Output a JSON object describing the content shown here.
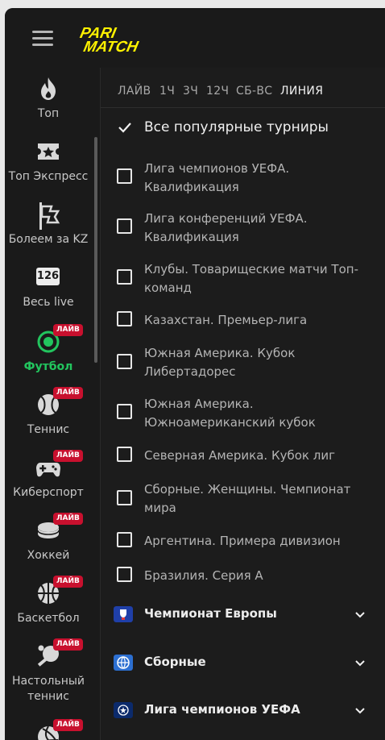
{
  "brand": {
    "logo_line1": "PARI",
    "logo_line2": "MATCH",
    "accent": "#fff200"
  },
  "sidebar": {
    "items": [
      {
        "label": "Топ",
        "icon": "flame-icon"
      },
      {
        "label": "Топ Экспресс",
        "icon": "ticket-star-icon"
      },
      {
        "label": "Болеем за KZ",
        "icon": "flag-icon"
      },
      {
        "label": "Весь live",
        "icon": "live-count-icon",
        "count": "126"
      },
      {
        "label": "Футбол",
        "icon": "football-icon",
        "badge": "ЛАЙВ",
        "active": true
      },
      {
        "label": "Теннис",
        "icon": "tennis-ball-icon",
        "badge": "ЛАЙВ"
      },
      {
        "label": "Киберспорт",
        "icon": "gamepad-icon",
        "badge": "ЛАЙВ"
      },
      {
        "label": "Хоккей",
        "icon": "hockey-puck-icon",
        "badge": "ЛАЙВ"
      },
      {
        "label": "Баскетбол",
        "icon": "basketball-icon",
        "badge": "ЛАЙВ"
      },
      {
        "label": "Настольный теннис",
        "icon": "table-tennis-icon",
        "badge": "ЛАЙВ"
      },
      {
        "label": "",
        "icon": "volleyball-icon",
        "badge": "ЛАЙВ"
      }
    ]
  },
  "tabs": [
    {
      "label": "ЛАЙВ"
    },
    {
      "label": "1Ч"
    },
    {
      "label": "3Ч"
    },
    {
      "label": "12Ч"
    },
    {
      "label": "СБ-ВС"
    },
    {
      "label": "ЛИНИЯ",
      "active": true
    }
  ],
  "all_popular": {
    "label": "Все популярные турниры",
    "checked": true
  },
  "tournaments": [
    {
      "label": "Лига чемпионов УЕФА. Квалификация",
      "checked": false
    },
    {
      "label": "Лига конференций УЕФА. Квалификация",
      "checked": false
    },
    {
      "label": "Клубы. Товарищеские матчи Топ-команд",
      "checked": false
    },
    {
      "label": "Казахстан. Премьер-лига",
      "checked": false
    },
    {
      "label": "Южная Америка. Кубок Либертадорес",
      "checked": false
    },
    {
      "label": "Южная Америка. Южноамериканский кубок",
      "checked": false
    },
    {
      "label": "Северная Америка. Кубок лиг",
      "checked": false
    },
    {
      "label": "Сборные. Женщины. Чемпионат мира",
      "checked": false
    },
    {
      "label": "Аргентина. Примера дивизион",
      "checked": false
    },
    {
      "label": "Бразилия. Серия А",
      "checked": false
    }
  ],
  "groups": [
    {
      "label": "Чемпионат Европы",
      "icon": "euro-cup-icon"
    },
    {
      "label": "Сборные",
      "icon": "globe-icon"
    },
    {
      "label": "Лига чемпионов УЕФА",
      "icon": "champions-league-icon"
    }
  ],
  "colors": {
    "active_green": "#22c55e",
    "live_badge": "#c8102e",
    "background": "#1a1a1a"
  }
}
